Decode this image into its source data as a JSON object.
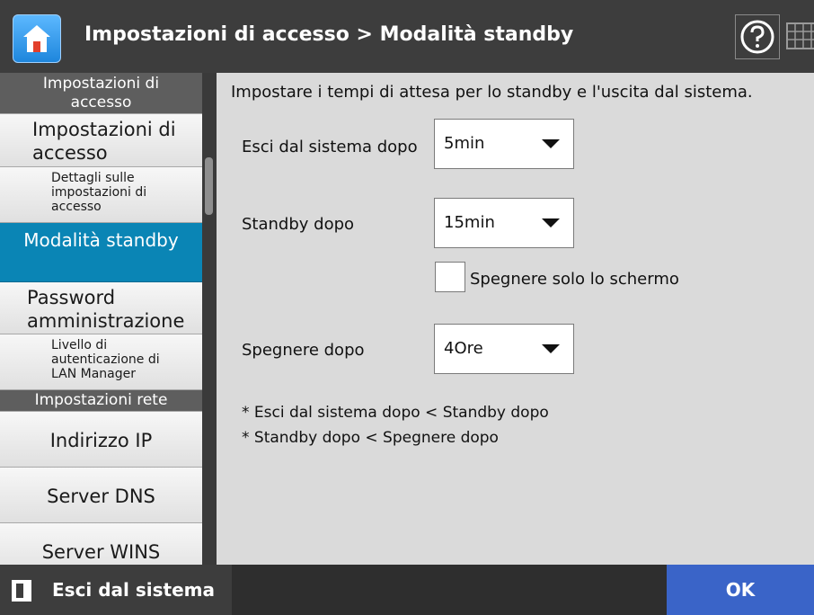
{
  "header": {
    "title": "Impostazioni di accesso > Modalità standby"
  },
  "sidebar": {
    "section_access": "Impostazioni di accesso",
    "items": [
      {
        "label": "Impostazioni di accesso"
      },
      {
        "label": "Dettagli sulle impostazioni di accesso"
      },
      {
        "label": "Modalità standby",
        "selected": true
      },
      {
        "label": "Password amministrazione"
      },
      {
        "label": "Livello di autenticazione di LAN Manager"
      }
    ],
    "section_network": "Impostazioni rete",
    "network_items": [
      {
        "label": "Indirizzo IP"
      },
      {
        "label": "Server DNS"
      },
      {
        "label": "Server WINS"
      }
    ]
  },
  "content": {
    "instruction": "Impostare i tempi di attesa per lo standby e l'uscita dal sistema.",
    "logout_after": {
      "label": "Esci dal sistema dopo",
      "value": "5min"
    },
    "standby_after": {
      "label": "Standby dopo",
      "value": "15min"
    },
    "screen_only": {
      "label": "Spegnere solo lo schermo",
      "checked": false
    },
    "shutdown_after": {
      "label": "Spegnere dopo",
      "value": "4Ore"
    },
    "notes": [
      "* Esci dal sistema dopo < Standby dopo",
      "* Standby dopo < Spegnere dopo"
    ]
  },
  "footer": {
    "logout_label": "Esci dal sistema",
    "ok_label": "OK"
  },
  "colors": {
    "selected": "#0a85b5",
    "ok_button": "#3a64c8",
    "section": "#5e5e5e"
  },
  "icons": {
    "home": "home-icon",
    "help": "help-icon",
    "keyboard": "keyboard-icon",
    "logout": "logout-icon"
  }
}
